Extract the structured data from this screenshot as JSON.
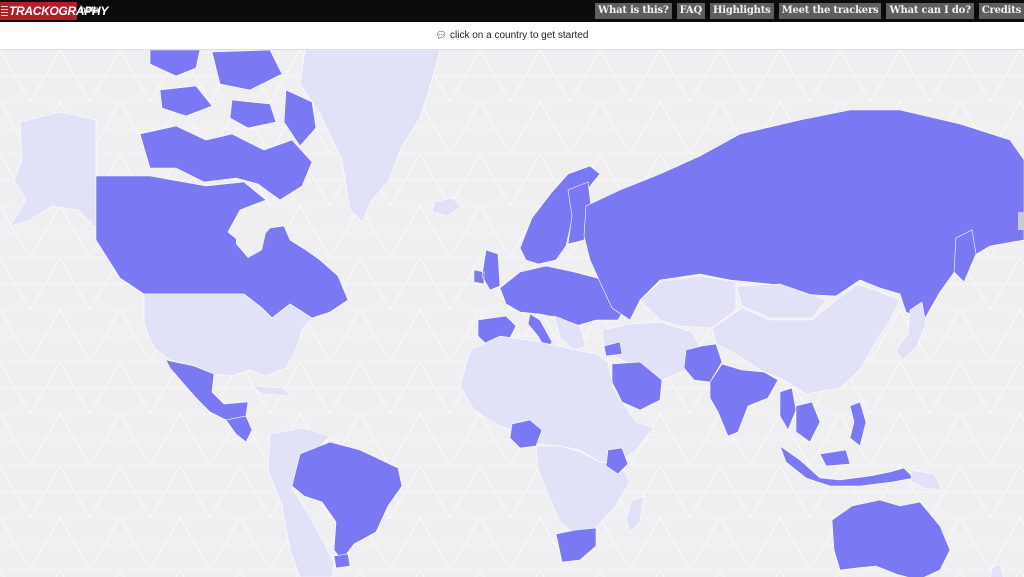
{
  "app": {
    "logo_text": "TRACKOGRAPHY",
    "badge": "beta"
  },
  "nav": {
    "items": [
      {
        "id": "what",
        "label": "What is this?"
      },
      {
        "id": "faq",
        "label": "FAQ"
      },
      {
        "id": "highlights",
        "label": "Highlights"
      },
      {
        "id": "trackers",
        "label": "Meet the trackers"
      },
      {
        "id": "can-do",
        "label": "What can I do?"
      },
      {
        "id": "credits",
        "label": "Credits"
      }
    ]
  },
  "hint": {
    "icon": "speech-bubble-icon",
    "text": "click on a country to get started"
  },
  "colors": {
    "tracked": "#7a78f2",
    "untracked": "#e1e1f7",
    "background": "#efeff2",
    "header": "#0b0b0b",
    "logo": "#b21e26"
  },
  "map": {
    "regions": [
      {
        "name": "canada",
        "status": "tracked"
      },
      {
        "name": "canadian-arctic-islands",
        "status": "tracked"
      },
      {
        "name": "alaska",
        "status": "untracked"
      },
      {
        "name": "greenland",
        "status": "untracked"
      },
      {
        "name": "iceland",
        "status": "untracked"
      },
      {
        "name": "united-states",
        "status": "untracked"
      },
      {
        "name": "mexico",
        "status": "tracked"
      },
      {
        "name": "central-america",
        "status": "tracked"
      },
      {
        "name": "cuba",
        "status": "untracked"
      },
      {
        "name": "brazil",
        "status": "tracked"
      },
      {
        "name": "uruguay",
        "status": "tracked"
      },
      {
        "name": "south-america-rest",
        "status": "untracked"
      },
      {
        "name": "uk-ireland",
        "status": "tracked"
      },
      {
        "name": "norway-sweden",
        "status": "tracked"
      },
      {
        "name": "finland",
        "status": "tracked"
      },
      {
        "name": "western-europe",
        "status": "tracked"
      },
      {
        "name": "spain-portugal",
        "status": "tracked"
      },
      {
        "name": "italy",
        "status": "tracked"
      },
      {
        "name": "balkans",
        "status": "untracked"
      },
      {
        "name": "russia",
        "status": "tracked"
      },
      {
        "name": "kazakhstan",
        "status": "untracked"
      },
      {
        "name": "china",
        "status": "untracked"
      },
      {
        "name": "mongolia",
        "status": "untracked"
      },
      {
        "name": "middle-east",
        "status": "untracked"
      },
      {
        "name": "saudi-arabia",
        "status": "tracked"
      },
      {
        "name": "syria",
        "status": "tracked"
      },
      {
        "name": "pakistan",
        "status": "tracked"
      },
      {
        "name": "india",
        "status": "tracked"
      },
      {
        "name": "myanmar",
        "status": "tracked"
      },
      {
        "name": "southeast-asia",
        "status": "tracked"
      },
      {
        "name": "philippines",
        "status": "tracked"
      },
      {
        "name": "japan",
        "status": "untracked"
      },
      {
        "name": "sakhalin",
        "status": "tracked"
      },
      {
        "name": "indonesia",
        "status": "tracked"
      },
      {
        "name": "papua-new-guinea",
        "status": "untracked"
      },
      {
        "name": "north-africa",
        "status": "untracked"
      },
      {
        "name": "nigeria",
        "status": "tracked"
      },
      {
        "name": "kenya",
        "status": "tracked"
      },
      {
        "name": "central-africa",
        "status": "untracked"
      },
      {
        "name": "south-africa",
        "status": "tracked"
      },
      {
        "name": "madagascar",
        "status": "untracked"
      },
      {
        "name": "australia",
        "status": "tracked"
      },
      {
        "name": "tasmania",
        "status": "tracked"
      },
      {
        "name": "new-zealand",
        "status": "untracked"
      }
    ]
  }
}
